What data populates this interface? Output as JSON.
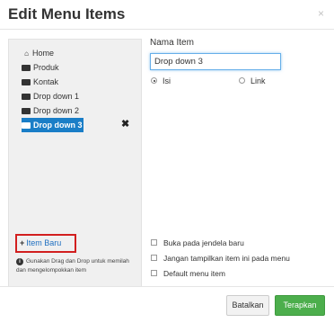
{
  "dialog": {
    "title": "Edit Menu Items",
    "close_label": "×"
  },
  "tree": {
    "items": [
      {
        "label": "Home",
        "icon": "home-icon"
      },
      {
        "label": "Produk",
        "icon": "folder-icon"
      },
      {
        "label": "Kontak",
        "icon": "folder-icon"
      },
      {
        "label": "Drop down 1",
        "icon": "folder-icon"
      },
      {
        "label": "Drop down 2",
        "icon": "folder-icon"
      },
      {
        "label": "Drop down 3",
        "icon": "folder-open-icon",
        "selected": true
      }
    ],
    "remove_label": "✖",
    "new_item_label": "Item Baru",
    "hint": "Gunakan Drag dan Drop untuk memilah dan mengelompokkan item"
  },
  "form": {
    "name_label": "Nama Item",
    "name_value": "Drop down 3",
    "type_options": [
      {
        "label": "Isi",
        "selected": true
      },
      {
        "label": "Link",
        "selected": false
      }
    ],
    "checkboxes": [
      {
        "label": "Buka pada jendela baru",
        "checked": false
      },
      {
        "label": "Jangan tampilkan item ini pada menu",
        "checked": false
      },
      {
        "label": "Default menu item",
        "checked": false
      }
    ]
  },
  "footer": {
    "cancel_label": "Batalkan",
    "apply_label": "Terapkan"
  },
  "colors": {
    "selected_bg": "#1a7ec7",
    "apply_bg": "#4cae4c",
    "highlight_border": "#d21f1f",
    "link_blue": "#1f6fc0"
  }
}
